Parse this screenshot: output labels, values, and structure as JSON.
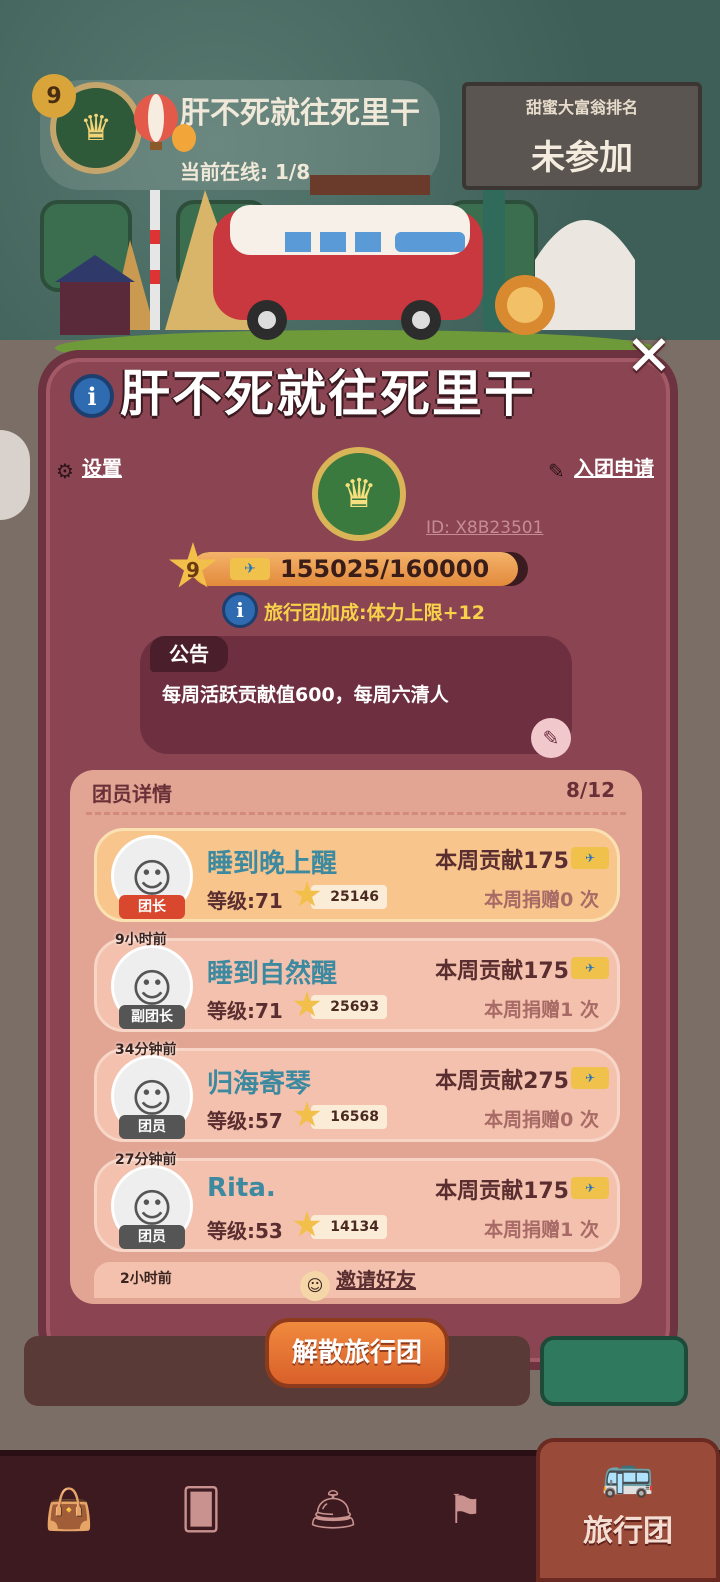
{
  "background": {
    "level": "9",
    "team_name": "肝不死就往死里干",
    "online_label": "当前在线:",
    "online_value": "1/8",
    "rank_board_title": "甜蜜大富翁排名",
    "rank_board_value": "未参加"
  },
  "modal": {
    "title": "肝不死就往死里干",
    "settings_label": "设置",
    "join_requests_label": "入团申请",
    "team_id": "ID: X8B23501",
    "team_level": "9",
    "progress_text": "155025/160000",
    "progress_fraction": 0.969,
    "bonus_text": "旅行团加成:体力上限+12",
    "notice": {
      "tab_label": "公告",
      "text": "每周活跃贡献值600，每周六清人"
    },
    "members": {
      "header_label": "团员详情",
      "count": "8/12",
      "list": [
        {
          "last_seen": "",
          "role": "团长",
          "name": "睡到晚上醒",
          "level": "等级:71",
          "score": "25146",
          "contribution": "本周贡献175",
          "donation": "本周捐赠0 次",
          "is_leader": true
        },
        {
          "last_seen": "9小时前",
          "role": "副团长",
          "name": "睡到自然醒",
          "level": "等级:71",
          "score": "25693",
          "contribution": "本周贡献175",
          "donation": "本周捐赠1 次",
          "is_leader": false
        },
        {
          "last_seen": "34分钟前",
          "role": "团员",
          "name": "归海寄琴",
          "level": "等级:57",
          "score": "16568",
          "contribution": "本周贡献275",
          "donation": "本周捐赠0 次",
          "is_leader": false
        },
        {
          "last_seen": "27分钟前",
          "role": "团员",
          "name": "Rita.",
          "level": "等级:53",
          "score": "14134",
          "contribution": "本周贡献175",
          "donation": "本周捐赠1 次",
          "is_leader": false
        }
      ],
      "partial_last_seen": "2小时前",
      "invite_label": "邀请好友"
    },
    "disband_button": "解散旅行团"
  },
  "nav": {
    "active_label": "旅行团",
    "icons": [
      "shop-bag-icon",
      "cards-icon",
      "service-bell-icon",
      "map-pin-icon",
      "bus-icon"
    ]
  },
  "colors": {
    "modal_bg": "#8b4552",
    "accent_orange": "#e0702e",
    "name_blue": "#3d8aa0",
    "bonus_yellow": "#f7d24a"
  }
}
